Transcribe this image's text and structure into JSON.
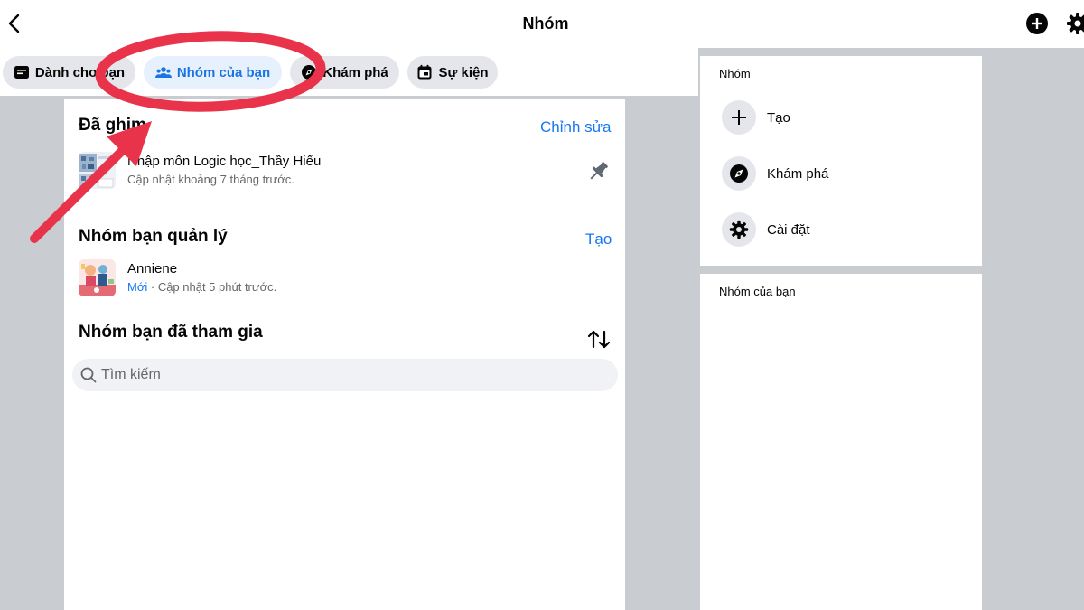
{
  "header": {
    "title": "Nhóm"
  },
  "tabs": [
    {
      "label": "Dành cho bạn",
      "icon": "feed-icon"
    },
    {
      "label": "Nhóm của bạn",
      "icon": "people-icon",
      "active": true
    },
    {
      "label": "Khám phá",
      "icon": "compass-icon"
    },
    {
      "label": "Sự kiện",
      "icon": "calendar-icon"
    }
  ],
  "pinned": {
    "title": "Đã ghim",
    "edit_label": "Chỉnh sửa",
    "groups": [
      {
        "name": "Nhập môn Logic học_Thầy Hiếu",
        "updated": "Cập nhật khoảng 7 tháng trước."
      }
    ]
  },
  "managed": {
    "title": "Nhóm bạn quản lý",
    "create_label": "Tạo",
    "groups": [
      {
        "name": "Anniene",
        "badge": "Mới",
        "separator": " · ",
        "updated": "Cập nhật 5 phút trước."
      }
    ]
  },
  "joined": {
    "title": "Nhóm bạn đã tham gia",
    "search_placeholder": "Tìm kiếm"
  },
  "sidebar": {
    "groups_label": "Nhóm",
    "items": [
      {
        "label": "Tạo",
        "icon": "plus-icon"
      },
      {
        "label": "Khám phá",
        "icon": "compass-icon"
      },
      {
        "label": "Cài đặt",
        "icon": "gear-icon"
      }
    ],
    "your_groups_label": "Nhóm của bạn"
  },
  "colors": {
    "accent": "#1877f2",
    "annotation": "#e8334a",
    "background": "#c9ccd1"
  }
}
